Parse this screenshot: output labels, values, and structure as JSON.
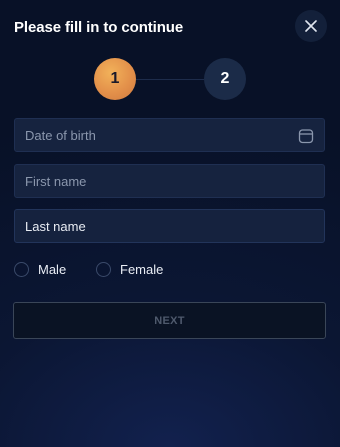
{
  "dialog": {
    "title": "Please fill in to continue",
    "close_icon": "close-icon"
  },
  "stepper": {
    "current_step": 1,
    "steps": [
      {
        "label": "1",
        "state": "active",
        "color": "#e3904a"
      },
      {
        "label": "2",
        "state": "inactive",
        "color": "#1b2b48"
      }
    ]
  },
  "form": {
    "date_of_birth": {
      "placeholder": "Date of birth",
      "value": "",
      "icon": "calendar-icon"
    },
    "first_name": {
      "placeholder": "First name",
      "value": ""
    },
    "last_name": {
      "placeholder": "Last name",
      "value": ""
    },
    "gender": {
      "options": [
        "Male",
        "Female"
      ],
      "selected": null
    }
  },
  "actions": {
    "next_label": "NEXT",
    "next_enabled": false
  },
  "theme": {
    "background": "#0b1633",
    "accent": "#e3904a",
    "field_bg": "#16233f"
  }
}
